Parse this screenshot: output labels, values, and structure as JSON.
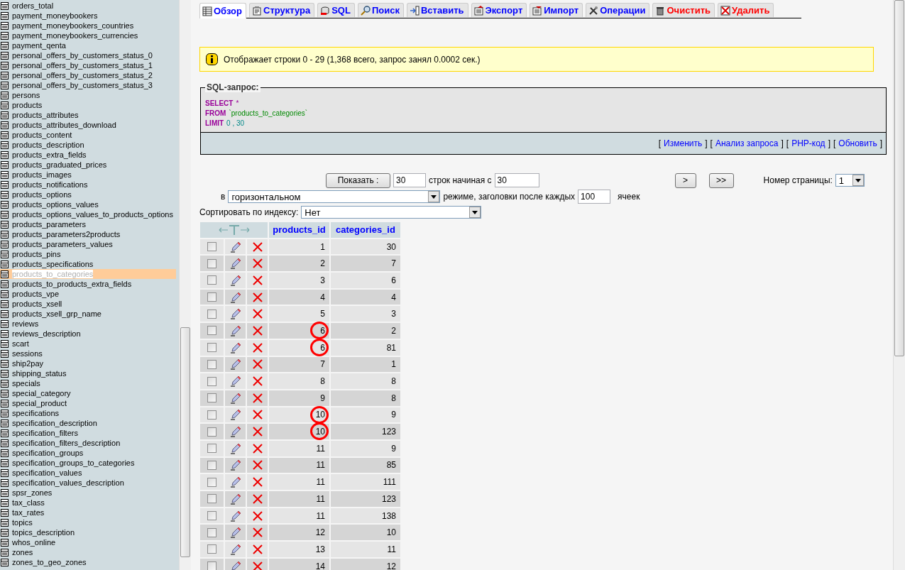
{
  "sidebar": {
    "tables": [
      {
        "name": "orders_total",
        "selected": false
      },
      {
        "name": "payment_moneybookers",
        "selected": false
      },
      {
        "name": "payment_moneybookers_countries",
        "selected": false
      },
      {
        "name": "payment_moneybookers_currencies",
        "selected": false
      },
      {
        "name": "payment_qenta",
        "selected": false
      },
      {
        "name": "personal_offers_by_customers_status_0",
        "selected": false
      },
      {
        "name": "personal_offers_by_customers_status_1",
        "selected": false
      },
      {
        "name": "personal_offers_by_customers_status_2",
        "selected": false
      },
      {
        "name": "personal_offers_by_customers_status_3",
        "selected": false
      },
      {
        "name": "persons",
        "selected": false
      },
      {
        "name": "products",
        "selected": false
      },
      {
        "name": "products_attributes",
        "selected": false
      },
      {
        "name": "products_attributes_download",
        "selected": false
      },
      {
        "name": "products_content",
        "selected": false
      },
      {
        "name": "products_description",
        "selected": false
      },
      {
        "name": "products_extra_fields",
        "selected": false
      },
      {
        "name": "products_graduated_prices",
        "selected": false
      },
      {
        "name": "products_images",
        "selected": false
      },
      {
        "name": "products_notifications",
        "selected": false
      },
      {
        "name": "products_options",
        "selected": false
      },
      {
        "name": "products_options_values",
        "selected": false
      },
      {
        "name": "products_options_values_to_products_options",
        "selected": false
      },
      {
        "name": "products_parameters",
        "selected": false
      },
      {
        "name": "products_parameters2products",
        "selected": false
      },
      {
        "name": "products_parameters_values",
        "selected": false
      },
      {
        "name": "products_pins",
        "selected": false
      },
      {
        "name": "products_specifications",
        "selected": false
      },
      {
        "name": "products_to_categories",
        "selected": true
      },
      {
        "name": "products_to_products_extra_fields",
        "selected": false
      },
      {
        "name": "products_vpe",
        "selected": false
      },
      {
        "name": "products_xsell",
        "selected": false
      },
      {
        "name": "products_xsell_grp_name",
        "selected": false
      },
      {
        "name": "reviews",
        "selected": false
      },
      {
        "name": "reviews_description",
        "selected": false
      },
      {
        "name": "scart",
        "selected": false
      },
      {
        "name": "sessions",
        "selected": false
      },
      {
        "name": "ship2pay",
        "selected": false
      },
      {
        "name": "shipping_status",
        "selected": false
      },
      {
        "name": "specials",
        "selected": false
      },
      {
        "name": "special_category",
        "selected": false
      },
      {
        "name": "special_product",
        "selected": false
      },
      {
        "name": "specifications",
        "selected": false
      },
      {
        "name": "specification_description",
        "selected": false
      },
      {
        "name": "specification_filters",
        "selected": false
      },
      {
        "name": "specification_filters_description",
        "selected": false
      },
      {
        "name": "specification_groups",
        "selected": false
      },
      {
        "name": "specification_groups_to_categories",
        "selected": false
      },
      {
        "name": "specification_values",
        "selected": false
      },
      {
        "name": "specification_values_description",
        "selected": false
      },
      {
        "name": "spsr_zones",
        "selected": false
      },
      {
        "name": "tax_class",
        "selected": false
      },
      {
        "name": "tax_rates",
        "selected": false
      },
      {
        "name": "topics",
        "selected": false
      },
      {
        "name": "topics_description",
        "selected": false
      },
      {
        "name": "whos_online",
        "selected": false
      },
      {
        "name": "zones",
        "selected": false
      },
      {
        "name": "zones_to_geo_zones",
        "selected": false
      }
    ]
  },
  "tabs": [
    {
      "label": "Обзор",
      "kind": "browse",
      "selected": true,
      "danger": false
    },
    {
      "label": "Структура",
      "kind": "structure",
      "selected": false,
      "danger": false
    },
    {
      "label": "SQL",
      "kind": "sql",
      "selected": false,
      "danger": false
    },
    {
      "label": "Поиск",
      "kind": "search",
      "selected": false,
      "danger": false
    },
    {
      "label": "Вставить",
      "kind": "insert",
      "selected": false,
      "danger": false
    },
    {
      "label": "Экспорт",
      "kind": "export",
      "selected": false,
      "danger": false
    },
    {
      "label": "Импорт",
      "kind": "import",
      "selected": false,
      "danger": false
    },
    {
      "label": "Операции",
      "kind": "operations",
      "selected": false,
      "danger": false
    },
    {
      "label": "Очистить",
      "kind": "empty",
      "selected": false,
      "danger": true
    },
    {
      "label": "Удалить",
      "kind": "drop",
      "selected": false,
      "danger": true
    }
  ],
  "notice": "Отображает строки 0 - 29 (1,368 всего, запрос занял 0.0002 сек.)",
  "sql_query": {
    "legend": "SQL-запрос:",
    "lines": [
      [
        {
          "kind": "keyword",
          "text": "SELECT"
        },
        {
          "kind": "operator",
          "text": "*"
        }
      ],
      [
        {
          "kind": "keyword",
          "text": "FROM"
        },
        {
          "kind": "identifier",
          "text": "`products_to_categories`"
        }
      ],
      [
        {
          "kind": "keyword",
          "text": "LIMIT"
        },
        {
          "kind": "number",
          "text": "0 , 30"
        }
      ]
    ],
    "links": [
      {
        "open": "[",
        "label": "Изменить",
        "close": "]"
      },
      {
        "open": "[",
        "label": "Анализ запроса",
        "close": "]"
      },
      {
        "open": "[",
        "label": "PHP-код",
        "close": "]"
      },
      {
        "open": "[",
        "label": "Обновить",
        "close": "]"
      }
    ]
  },
  "navigation": {
    "show_button": "Показать :",
    "row_count": "30",
    "start_label": "строк начиная с",
    "start": "30",
    "next_button": ">",
    "last_button": ">>",
    "page_label": "Номер страницы:",
    "page": "1",
    "mode_prefix": "в",
    "mode": "горизонтальном",
    "repeat_label": "режиме, заголовки после каждых",
    "repeat": "100",
    "cells_label": "ячеек",
    "sort_label": "Сортировать по индексу:",
    "sort": "Нет"
  },
  "table": {
    "columns": [
      "products_id",
      "categories_id"
    ],
    "rows": [
      {
        "checked": false,
        "circled": false,
        "cells": [
          "1",
          "30"
        ]
      },
      {
        "checked": false,
        "circled": false,
        "cells": [
          "2",
          "7"
        ]
      },
      {
        "checked": false,
        "circled": false,
        "cells": [
          "3",
          "6"
        ]
      },
      {
        "checked": false,
        "circled": false,
        "cells": [
          "4",
          "4"
        ]
      },
      {
        "checked": false,
        "circled": false,
        "cells": [
          "5",
          "3"
        ]
      },
      {
        "checked": false,
        "circled": true,
        "cells": [
          "6",
          "2"
        ]
      },
      {
        "checked": false,
        "circled": true,
        "cells": [
          "6",
          "81"
        ]
      },
      {
        "checked": false,
        "circled": false,
        "cells": [
          "7",
          "1"
        ]
      },
      {
        "checked": false,
        "circled": false,
        "cells": [
          "8",
          "8"
        ]
      },
      {
        "checked": false,
        "circled": false,
        "cells": [
          "9",
          "8"
        ]
      },
      {
        "checked": false,
        "circled": true,
        "cells": [
          "10",
          "9"
        ]
      },
      {
        "checked": false,
        "circled": true,
        "cells": [
          "10",
          "123"
        ]
      },
      {
        "checked": false,
        "circled": false,
        "cells": [
          "11",
          "9"
        ]
      },
      {
        "checked": false,
        "circled": false,
        "cells": [
          "11",
          "85"
        ]
      },
      {
        "checked": false,
        "circled": false,
        "cells": [
          "11",
          "111"
        ]
      },
      {
        "checked": false,
        "circled": false,
        "cells": [
          "11",
          "123"
        ]
      },
      {
        "checked": false,
        "circled": false,
        "cells": [
          "11",
          "138"
        ]
      },
      {
        "checked": false,
        "circled": false,
        "cells": [
          "12",
          "10"
        ]
      },
      {
        "checked": false,
        "circled": false,
        "cells": [
          "13",
          "11"
        ]
      },
      {
        "checked": false,
        "circled": false,
        "cells": [
          "14",
          "12"
        ]
      }
    ]
  }
}
